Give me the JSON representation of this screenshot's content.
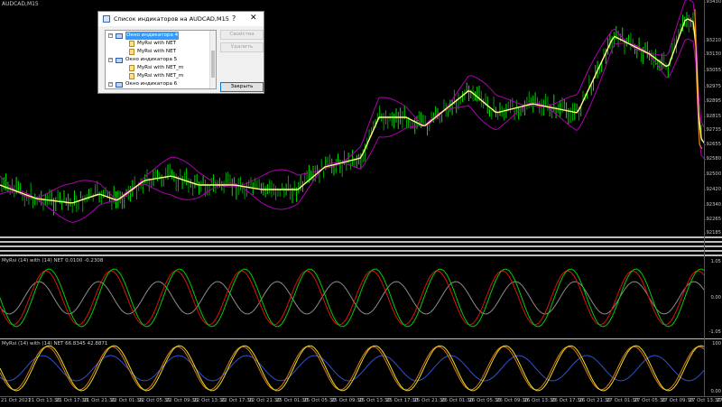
{
  "chart": {
    "symbol_title": "AUDCAD,M15",
    "price_scale": [
      "0.93430",
      "0.93285",
      "0.93210",
      "0.93130",
      "0.93055",
      "0.92975",
      "0.92895",
      "0.92815",
      "0.92735",
      "0.92655",
      "0.92580",
      "0.92500",
      "0.92420",
      "0.92340",
      "0.92265",
      "0.92185"
    ],
    "colors": {
      "background": "#000000",
      "candle_bull": "#00e000",
      "candle_bear": "#00a000",
      "ma_yellow": "#ffff80",
      "band_magenta": "#b000b0",
      "band_orange": "#ff8c1a"
    }
  },
  "panel_rsi": {
    "title": "MyRsi (14) with (14) NET 0.0100 -0.2308",
    "scale": [
      "1.05",
      "0.00",
      "-1.05"
    ],
    "colors": {
      "green": "#00d000",
      "red": "#e01010",
      "gray": "#8c8c8c"
    }
  },
  "panel_rsi2": {
    "title": "MyRsi (14) with (14) NET 66.8345 42.8871",
    "scale": [
      "100",
      "0.00"
    ],
    "colors": {
      "orange": "#e07a10",
      "yellow": "#e8e020",
      "blue": "#3050d0"
    }
  },
  "time_axis": [
    "21 Oct 2021",
    "21 Oct 13:30",
    "21 Oct 17:30",
    "21 Oct 21:30",
    "22 Oct 01:30",
    "22 Oct 05:30",
    "22 Oct 09:30",
    "22 Oct 13:30",
    "22 Oct 17:30",
    "22 Oct 21:30",
    "25 Oct 01:30",
    "25 Oct 05:30",
    "25 Oct 09:30",
    "25 Oct 13:30",
    "25 Oct 17:30",
    "25 Oct 21:30",
    "26 Oct 01:30",
    "26 Oct 05:30",
    "26 Oct 09:30",
    "26 Oct 13:30",
    "26 Oct 17:30",
    "26 Oct 21:30",
    "27 Oct 01:30",
    "27 Oct 05:30",
    "27 Oct 09:30",
    "27 Oct 13:30",
    "27 Oct 17:30"
  ],
  "dialog": {
    "title": "Список индикаторов на AUDCAD,M15",
    "help_glyph": "?",
    "close_glyph": "✕",
    "tree": [
      {
        "level": 0,
        "type": "window",
        "label": "Окно индикатора 4",
        "selected": true,
        "expander": "−"
      },
      {
        "level": 1,
        "type": "indicator",
        "label": "MyRsi with NET"
      },
      {
        "level": 1,
        "type": "indicator",
        "label": "MyRsi with NET"
      },
      {
        "level": 0,
        "type": "window",
        "label": "Окно индикатора 5",
        "expander": "−"
      },
      {
        "level": 1,
        "type": "indicator",
        "label": "MyRsi with NET_m"
      },
      {
        "level": 1,
        "type": "indicator",
        "label": "MyRsi with NET_m"
      },
      {
        "level": 0,
        "type": "window",
        "label": "Окно индикатора 6",
        "expander": "−"
      },
      {
        "level": 1,
        "type": "indicator",
        "label": "MyRsi with NET_m"
      },
      {
        "level": 1,
        "type": "indicator",
        "label": "MyRsi with NET_m"
      }
    ],
    "buttons": {
      "properties": "Свойства",
      "delete": "Удалить",
      "close": "Закрыть"
    }
  }
}
